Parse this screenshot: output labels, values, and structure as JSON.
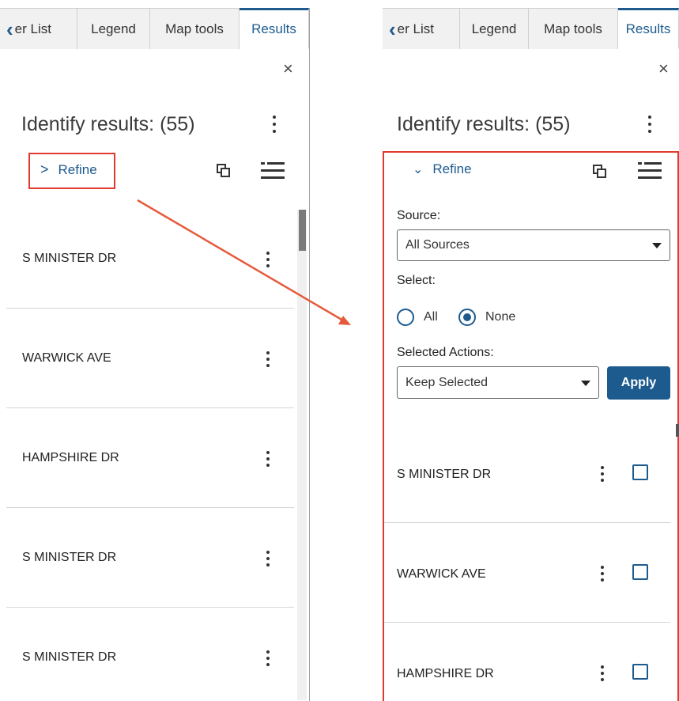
{
  "tabs": [
    {
      "label": "er List",
      "has_back_chevron": true,
      "active": false
    },
    {
      "label": "Legend",
      "active": false
    },
    {
      "label": "Map tools",
      "active": false
    },
    {
      "label": "Results",
      "active": true
    }
  ],
  "panel": {
    "title": "Identify results: (55)",
    "refine_label": "Refine",
    "close_icon": "×"
  },
  "refine_panel": {
    "source_label": "Source:",
    "source_value": "All Sources",
    "select_label": "Select:",
    "radio_options": [
      {
        "label": "All",
        "selected": false
      },
      {
        "label": "None",
        "selected": true
      }
    ],
    "actions_label": "Selected Actions:",
    "actions_value": "Keep Selected",
    "apply_label": "Apply"
  },
  "left_results": [
    "S MINISTER DR",
    "WARWICK AVE",
    "HAMPSHIRE DR",
    "S MINISTER DR",
    "S MINISTER DR"
  ],
  "right_results": [
    "S MINISTER DR",
    "WARWICK AVE",
    "HAMPSHIRE DR"
  ],
  "colors": {
    "accent": "#1d5b8f",
    "highlight": "#e03a2e"
  }
}
